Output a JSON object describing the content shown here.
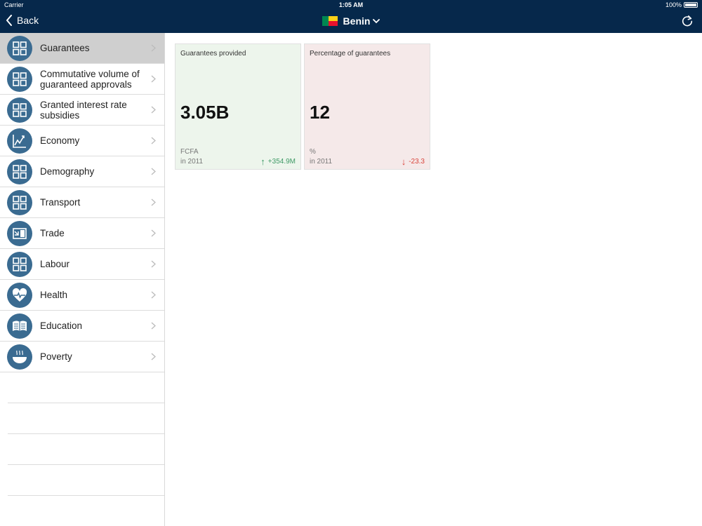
{
  "status": {
    "carrier": "Carrier",
    "time": "1:05 AM",
    "battery": "100%"
  },
  "nav": {
    "back_label": "Back",
    "country": "Benin",
    "flag_colors": [
      "#008751",
      "#fcd116",
      "#e8112d"
    ]
  },
  "sidebar": {
    "items": [
      {
        "label": "Guarantees",
        "icon": "grid-icon",
        "active": true
      },
      {
        "label": "Commutative volume of guaranteed approvals",
        "icon": "grid-icon"
      },
      {
        "label": "Granted interest rate subsidies",
        "icon": "grid-icon"
      },
      {
        "label": "Economy",
        "icon": "chart-icon"
      },
      {
        "label": "Demography",
        "icon": "grid-icon"
      },
      {
        "label": "Transport",
        "icon": "grid-icon"
      },
      {
        "label": "Trade",
        "icon": "trade-icon"
      },
      {
        "label": "Labour",
        "icon": "grid-icon"
      },
      {
        "label": "Health",
        "icon": "heart-icon"
      },
      {
        "label": "Education",
        "icon": "book-icon"
      },
      {
        "label": "Poverty",
        "icon": "bowl-icon"
      }
    ]
  },
  "cards": [
    {
      "title": "Guarantees provided",
      "value": "3.05B",
      "unit": "FCFA",
      "year": "in 2011",
      "delta": "+354.9M",
      "trend": "up",
      "color": "#edf5ec"
    },
    {
      "title": "Percentage of guarantees",
      "value": "12",
      "unit": "%",
      "year": "in 2011",
      "delta": "-23.3",
      "trend": "down",
      "color": "#f5e9e9"
    }
  ]
}
